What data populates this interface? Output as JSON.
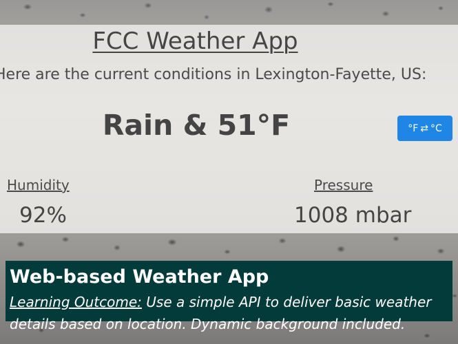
{
  "app": {
    "title": "FCC Weather App",
    "subtitle": "Here are the current conditions in Lexington-Fayette, US:",
    "conditions": "Rain & 51°F",
    "unit_toggle": {
      "label_from": "°F",
      "arrow": "⇄",
      "label_to": "°C",
      "color": "#1f86e6"
    },
    "humidity": {
      "label": "Humidity",
      "value": "92%"
    },
    "pressure": {
      "label": "Pressure",
      "value": "1008 mbar"
    },
    "background": "rain-on-window"
  },
  "info": {
    "heading": "Web-based Weather App",
    "outcome_label": "Learning Outcome:",
    "outcome_text": " Use a simple API to deliver basic weather details based on location. Dynamic background included.",
    "background_color": "#033b3a"
  }
}
